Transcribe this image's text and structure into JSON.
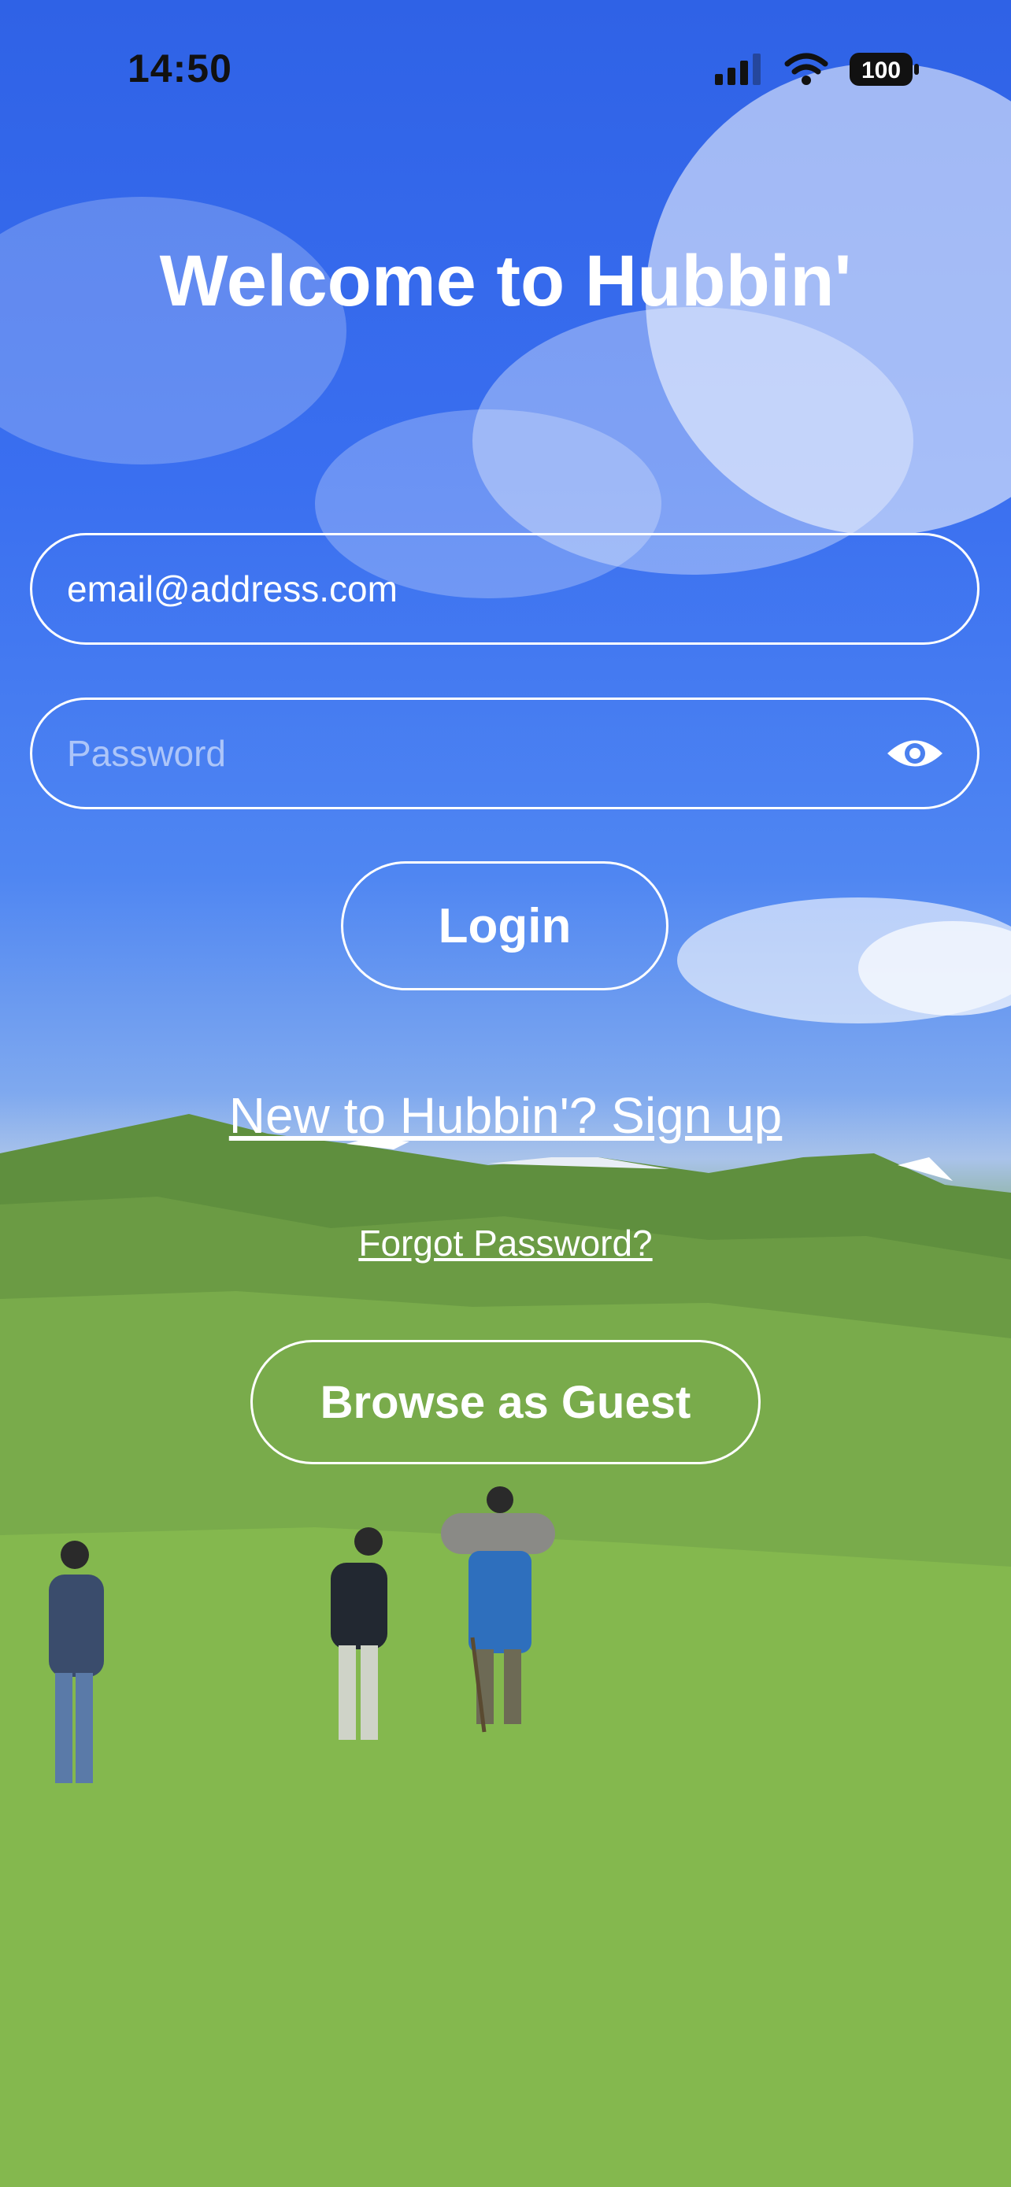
{
  "status_bar": {
    "time": "14:50",
    "battery": "100",
    "icons": [
      "signal-icon",
      "wifi-icon",
      "battery-icon"
    ]
  },
  "title": "Welcome to Hubbin'",
  "email_field": {
    "value": "email@address.com"
  },
  "password_field": {
    "placeholder": "Password",
    "icon": "eye-icon"
  },
  "login_label": "Login",
  "signup_link": "New to Hubbin'? Sign up",
  "forgot_link": "Forgot Password?",
  "guest_label": "Browse as Guest",
  "colors": {
    "sky": "#3a6ff0",
    "grass": "#7bb04d",
    "foreground": "#ffffff"
  }
}
